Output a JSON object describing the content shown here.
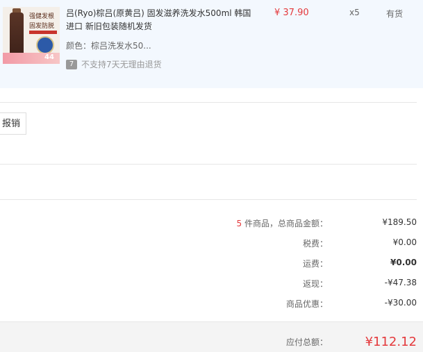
{
  "item": {
    "image_alt_lines": [
      "强健发根",
      "固发防脱"
    ],
    "image_badge": "44",
    "title": "吕(Ryo)棕吕(原黄吕) 固发滋养洗发水500ml 韩国进口 新旧包装随机发货",
    "color": "颜色：棕吕洗发水50...",
    "return_icon": "7",
    "return_policy": "不支持7天无理由退货",
    "price": "¥ 37.90",
    "quantity": "x5",
    "stock": "有货"
  },
  "invoice": {
    "button_label": "报销"
  },
  "summary": {
    "count": "5",
    "count_label": " 件商品，总商品金额：",
    "total_goods": "¥189.50",
    "tax_label": "税费：",
    "tax": "¥0.00",
    "shipping_label": "运费：",
    "shipping": "¥0.00",
    "cashback_label": "返现：",
    "cashback": "-¥47.38",
    "discount_label": "商品优惠：",
    "discount": "-¥30.00"
  },
  "total": {
    "label": "应付总额：",
    "value": "¥112.12"
  },
  "colors": {
    "accent": "#e4393c",
    "item_bg": "#f3f8fe",
    "total_bg": "#f4f4f4"
  }
}
